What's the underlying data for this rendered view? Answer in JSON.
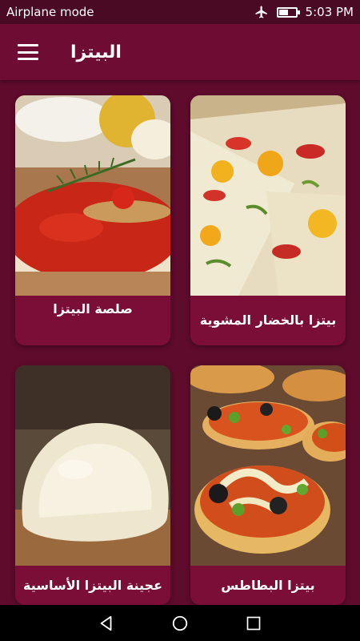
{
  "status_bar": {
    "left_text": "Airplane mode",
    "time": "5:03 PM"
  },
  "app_bar": {
    "title": "البيتزا",
    "menu_icon": "hamburger-menu-icon"
  },
  "recipes": [
    {
      "title": "بيتزا بالخضار المشوية"
    },
    {
      "title": "صلصة البيتزا"
    },
    {
      "title": "بيتزا البطاطس"
    },
    {
      "title": "عجينة البيتزا الأساسية"
    }
  ],
  "nav_bar": {
    "icons": [
      "back-icon",
      "home-icon",
      "recents-icon"
    ]
  },
  "colors": {
    "background": "#5e0b2c",
    "app_bar": "#6e0c34",
    "card": "#7b0e37",
    "status_bar": "#4a0a23"
  }
}
